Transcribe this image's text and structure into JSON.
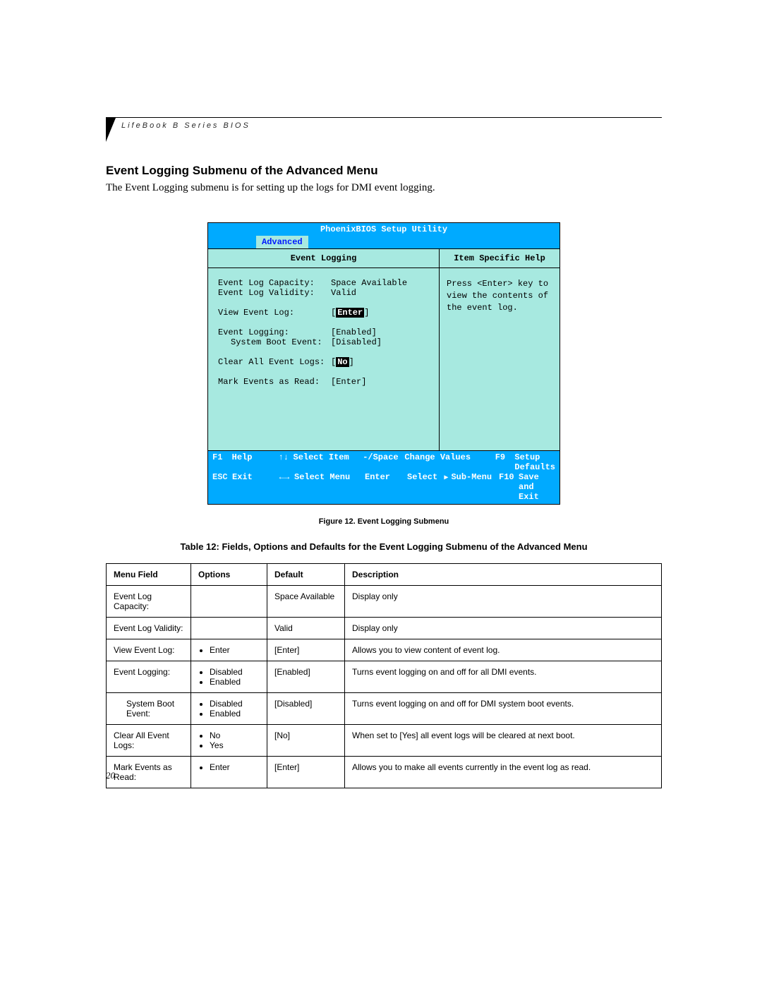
{
  "running_head": "LifeBook B Series BIOS",
  "section_title": "Event Logging Submenu of the Advanced Menu",
  "intro": "The Event Logging submenu is for setting up the logs  for DMI event logging.",
  "bios": {
    "title": "PhoenixBIOS Setup Utility",
    "active_tab": "Advanced",
    "left_heading": "Event Logging",
    "right_heading": "Item Specific Help",
    "help_text": "Press <Enter> key to view the contents of the event log.",
    "rows": [
      {
        "label": "Event Log Capacity:",
        "value": "Space Available",
        "spacer": false,
        "indent": false,
        "selected": false
      },
      {
        "label": "Event Log Validity:",
        "value": "Valid",
        "spacer": false,
        "indent": false,
        "selected": false
      },
      {
        "label": "View Event Log:",
        "value": "Enter",
        "spacer": true,
        "indent": false,
        "selected": true,
        "brackets": true
      },
      {
        "label": "Event Logging:",
        "value": "[Enabled]",
        "spacer": true,
        "indent": false,
        "selected": false
      },
      {
        "label": "System Boot Event:",
        "value": "[Disabled]",
        "spacer": false,
        "indent": true,
        "selected": false
      },
      {
        "label": "Clear All Event Logs:",
        "value": "No",
        "spacer": true,
        "indent": false,
        "selected": true,
        "brackets": true
      },
      {
        "label": "Mark Events as Read:",
        "value": "[Enter]",
        "spacer": true,
        "indent": false,
        "selected": false
      }
    ],
    "footer": {
      "r1": {
        "k1": "F1",
        "t1": "Help",
        "k2": "↑↓",
        "t2": "Select Item",
        "k3": "-/Space",
        "t3": "Change Values",
        "k4": "F9",
        "t4": "Setup Defaults"
      },
      "r2": {
        "k1": "ESC",
        "t1": "Exit",
        "k2": "←→",
        "t2": "Select Menu",
        "k3": "Enter",
        "t3": "Select  Sub-Menu",
        "k4": "F10",
        "t4": "Save and Exit"
      }
    }
  },
  "figure_caption": "Figure 12.  Event Logging Submenu",
  "table_caption": "Table 12: Fields, Options and Defaults for the Event Logging Submenu of the Advanced Menu",
  "table": {
    "headers": [
      "Menu Field",
      "Options",
      "Default",
      "Description"
    ],
    "rows": [
      {
        "field": "Event Log Capacity:",
        "indent": false,
        "options": [],
        "default": "Space Available",
        "desc": "Display only"
      },
      {
        "field": "Event Log Validity:",
        "indent": false,
        "options": [],
        "default": "Valid",
        "desc": "Display only"
      },
      {
        "field": "View Event Log:",
        "indent": false,
        "options": [
          "Enter"
        ],
        "default": "[Enter]",
        "desc": "Allows you to view content of event log."
      },
      {
        "field": "Event Logging:",
        "indent": false,
        "options": [
          "Disabled",
          "Enabled"
        ],
        "default": "[Enabled]",
        "desc": "Turns event logging on and off for all DMI events."
      },
      {
        "field": "System Boot Event:",
        "indent": true,
        "options": [
          "Disabled",
          "Enabled"
        ],
        "default": "[Disabled]",
        "desc": "Turns event logging on and off for DMI system boot events."
      },
      {
        "field": "Clear All Event Logs:",
        "indent": false,
        "options": [
          "No",
          "Yes"
        ],
        "default": "[No]",
        "desc": "When set to [Yes] all event logs will be cleared at next boot."
      },
      {
        "field": "Mark Events as Read:",
        "indent": false,
        "options": [
          "Enter"
        ],
        "default": "[Enter]",
        "desc": "Allows you to make all events currently in the event log as read."
      }
    ]
  },
  "page_number": "20"
}
